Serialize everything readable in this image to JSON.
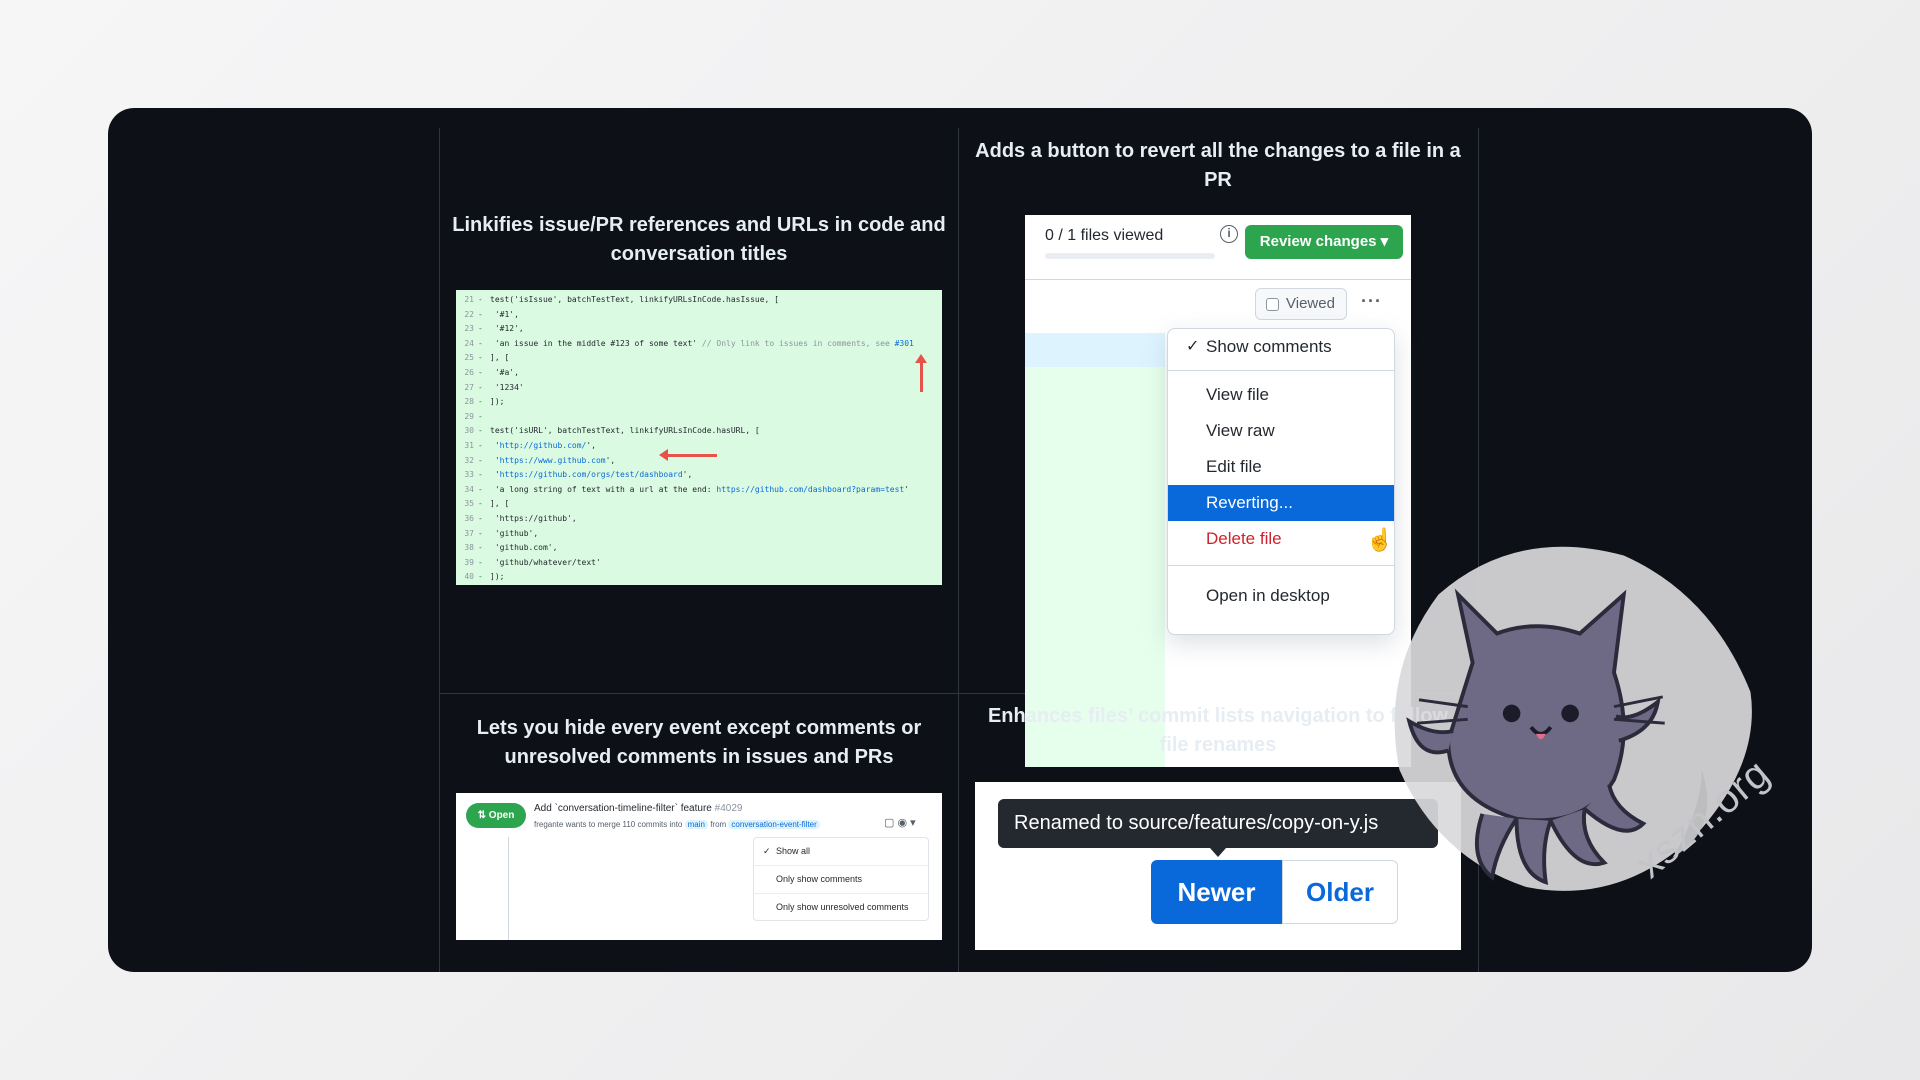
{
  "features": {
    "linkify": {
      "caption": "Linkifies issue/PR references and URLs in code and conversation titles",
      "code_lines": [
        {
          "ln": "21",
          "mark": "-",
          "text": "test('isIssue', batchTestText, linkifyURLsInCode.hasIssue, ["
        },
        {
          "ln": "22",
          "mark": "-",
          "text": "    '#1',"
        },
        {
          "ln": "23",
          "mark": "-",
          "text": "    '#12',"
        },
        {
          "ln": "24",
          "mark": "-",
          "text": "    'an issue in the middle #123 of some text'",
          "comment": " // Only link to issues in comments, see ",
          "link": "#301"
        },
        {
          "ln": "25",
          "mark": "-",
          "text": "], ["
        },
        {
          "ln": "26",
          "mark": "-",
          "text": "    '#a',"
        },
        {
          "ln": "27",
          "mark": "-",
          "text": "    '1234'"
        },
        {
          "ln": "28",
          "mark": "-",
          "text": "]);"
        },
        {
          "ln": "29",
          "mark": "-",
          "text": ""
        },
        {
          "ln": "30",
          "mark": "-",
          "text": "test('isURL', batchTestText, linkifyURLsInCode.hasURL, ["
        },
        {
          "ln": "31",
          "mark": "-",
          "text": "    '",
          "link": "http://github.com/",
          "after": "',"
        },
        {
          "ln": "32",
          "mark": "-",
          "text": "    '",
          "link": "https://www.github.com",
          "after": "',"
        },
        {
          "ln": "33",
          "mark": "-",
          "text": "    '",
          "link": "https://github.com/orgs/test/dashboard",
          "after": "',"
        },
        {
          "ln": "34",
          "mark": "-",
          "text": "    'a long string of text with a url at the end: ",
          "link": "https://github.com/dashboard?param=test",
          "after": "'"
        },
        {
          "ln": "35",
          "mark": "-",
          "text": "], ["
        },
        {
          "ln": "36",
          "mark": "-",
          "text": "    'https://github',"
        },
        {
          "ln": "37",
          "mark": "-",
          "text": "    'github',"
        },
        {
          "ln": "38",
          "mark": "-",
          "text": "    'github.com',"
        },
        {
          "ln": "39",
          "mark": "-",
          "text": "    'github/whatever/text'"
        },
        {
          "ln": "40",
          "mark": "-",
          "text": "]);"
        }
      ]
    },
    "revert": {
      "caption": "Adds a button to revert all the changes to a file in a PR",
      "files_viewed": "0 / 1 files viewed",
      "info_icon": "info-icon",
      "review_button": "Review changes ▾",
      "viewed_label": "Viewed",
      "kebab": "···",
      "menu": {
        "check": "✓",
        "show_comments": "Show comments",
        "view_file": "View file",
        "view_raw": "View raw",
        "edit_file": "Edit file",
        "reverting": "Reverting...",
        "delete_file": "Delete file",
        "open_desktop": "Open in desktop"
      },
      "cursor": "☝"
    },
    "timeline": {
      "caption": "Lets you hide every event except comments or unresolved comments in issues and PRs",
      "badge": "⇅ Open",
      "title": "Add `conversation-timeline-filter` feature",
      "number": "#4029",
      "sub_prefix": "fregante wants to merge 110 commits into",
      "base_branch": "main",
      "sub_from": "from",
      "head_branch": "conversation-event-filter",
      "icons": "▢ ◉ ▾",
      "options": {
        "check": "✓",
        "show_all": "Show all",
        "only_comments": "Only show comments",
        "only_unresolved": "Only show unresolved comments"
      }
    },
    "renames": {
      "caption": "Enhances files’ commit lists navigation to follow file renames",
      "tooltip": "Renamed to source/features/copy-on-y.js",
      "newer": "Newer",
      "older": "Older"
    }
  },
  "watermark": "xszn.org",
  "colors": {
    "background": "#0d1117",
    "accent_blue": "#0969da",
    "success_green": "#2da44e",
    "danger_red": "#cf222e"
  }
}
